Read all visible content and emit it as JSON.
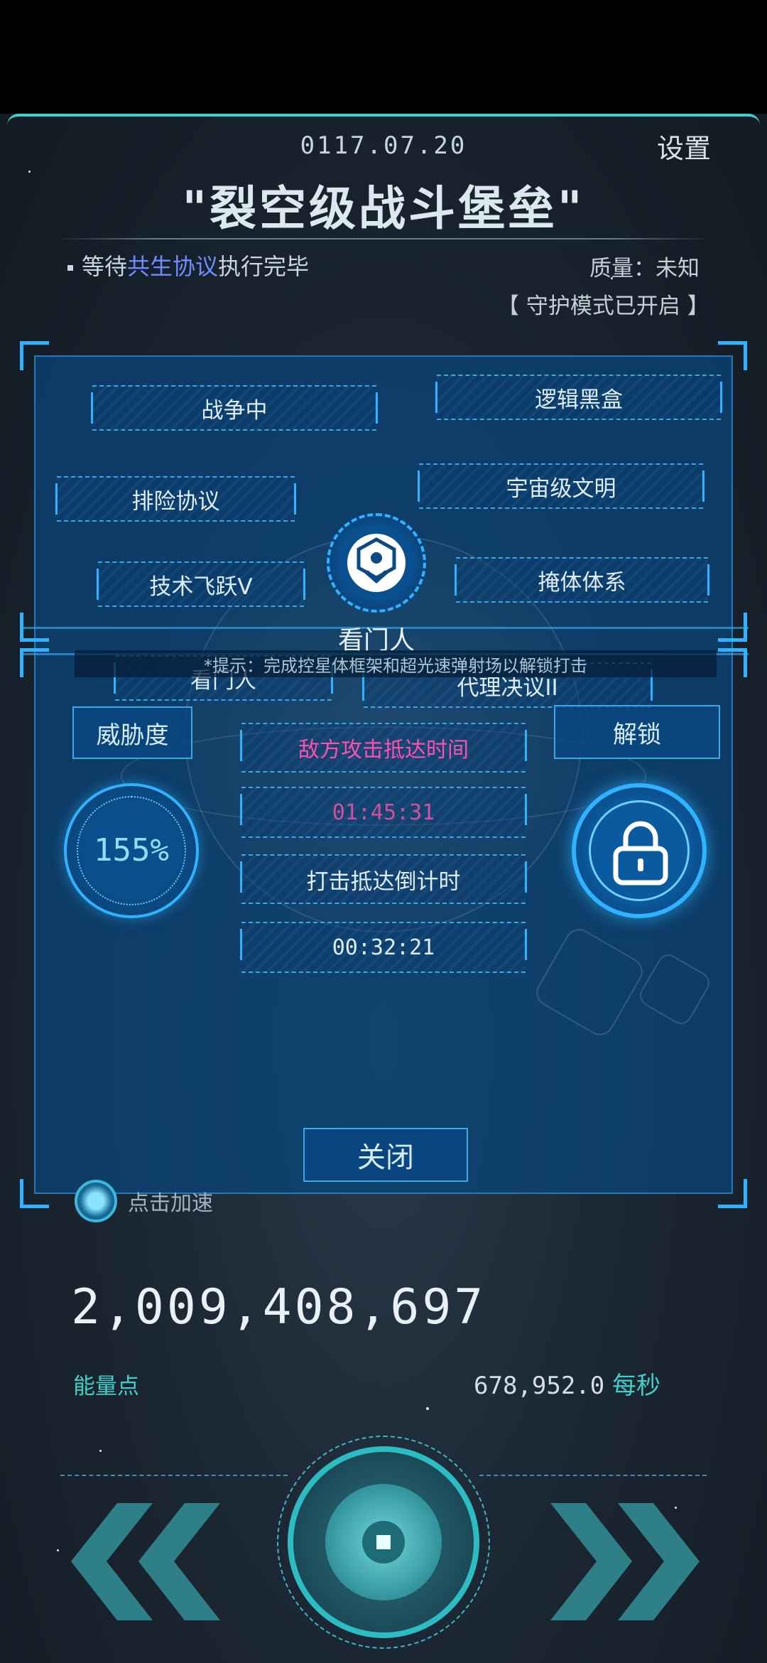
{
  "header": {
    "date": "0117.07.20",
    "settings_label": "设置",
    "title": "\"裂空级战斗堡垒\""
  },
  "status": {
    "prefix": "等待",
    "highlight": "共生协议",
    "suffix": "执行完毕",
    "quality": "质量：未知",
    "mode": "【 守护模式已开启 】"
  },
  "panel": {
    "tags": [
      "战争中",
      "逻辑黑盒",
      "排险协议",
      "宇宙级文明",
      "技术飞跃V",
      "掩体体系",
      "看门人",
      "代理决议II"
    ],
    "center_label": "看门人",
    "hint": "*提示：完成控星体框架和超光速弹射场以解锁打击",
    "threat_label": "威胁度",
    "threat_value": "155%",
    "unlock_label": "解锁",
    "enemy_attack_label": "敌方攻击抵达时间",
    "enemy_attack_time": "01:45:31",
    "strike_label": "打击抵达倒计时",
    "strike_time": "00:32:21",
    "close_label": "关闭",
    "accelerate_label": "点击加速"
  },
  "energy": {
    "value": "2,009,408,697",
    "label": "能量点",
    "rate_value": "678,952.0",
    "rate_unit": "每秒"
  },
  "colors": {
    "accent": "#2fb2ff",
    "teal": "#3fd0c9",
    "highlight": "#6f8cff",
    "warning": "#ff4fb0"
  }
}
